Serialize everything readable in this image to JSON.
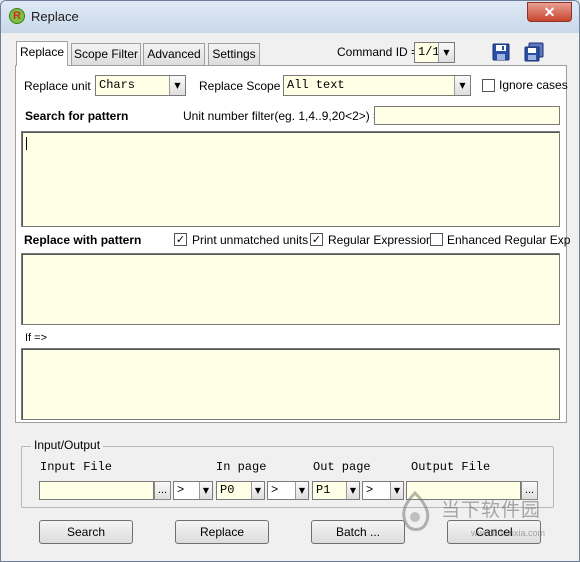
{
  "window": {
    "title": "Replace",
    "app_icon": "R",
    "close_symbol": "✕"
  },
  "tabs": [
    {
      "label": "Replace",
      "active": true
    },
    {
      "label": "Scope Filter",
      "active": false
    },
    {
      "label": "Advanced",
      "active": false
    },
    {
      "label": "Settings",
      "active": false
    }
  ],
  "command": {
    "label": "Command ID =>",
    "value": "1/1"
  },
  "replace_unit": {
    "label": "Replace unit",
    "value": "Chars"
  },
  "replace_scope": {
    "label": "Replace Scope",
    "value": "All text"
  },
  "ignore_cases": {
    "label": "Ignore cases",
    "checked": false
  },
  "search": {
    "label": "Search for pattern",
    "unit_filter_label": "Unit number filter(eg. 1,4..9,20<2>) =>",
    "unit_filter_value": "",
    "pattern": ""
  },
  "replace_with": {
    "label": "Replace with pattern",
    "print_unmatched": {
      "label": "Print unmatched units",
      "checked": true
    },
    "regular_expression": {
      "label": "Regular Expression",
      "checked": true
    },
    "enhanced_regexp": {
      "label": "Enhanced Regular Exp",
      "checked": false
    },
    "pattern": ""
  },
  "if_section": {
    "label": "If =>",
    "value": ""
  },
  "io": {
    "group_label": "Input/Output",
    "input_file_label": "Input File",
    "in_page_label": "In page",
    "out_page_label": "Out page",
    "output_file_label": "Output File",
    "input_file": "",
    "input_op": ">",
    "in_page": "P0",
    "in_op": ">",
    "out_page": "P1",
    "out_op": ">",
    "output_file": "",
    "browse": "..."
  },
  "buttons": {
    "search": "Search",
    "replace": "Replace",
    "batch": "Batch ...",
    "cancel": "Cancel"
  },
  "watermark": {
    "text_cn": "当下软件园",
    "text_url": "www.downxia.com"
  },
  "colors": {
    "field_bg": "#ffffe6",
    "title_bar": "#c9d8ea",
    "close_red": "#c9452f"
  }
}
